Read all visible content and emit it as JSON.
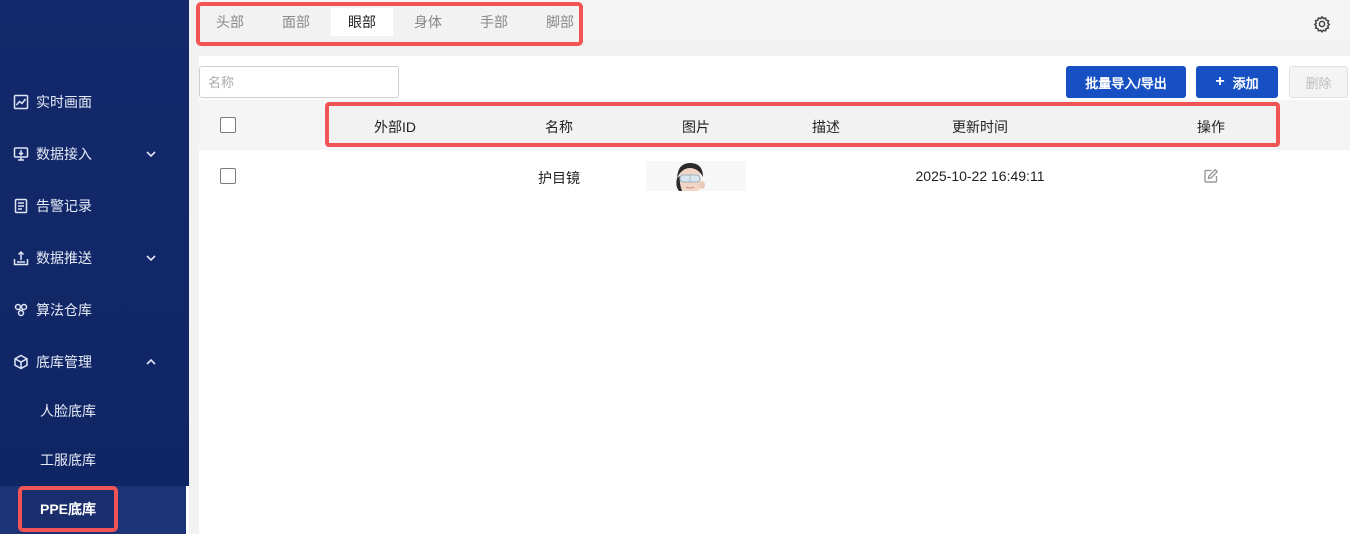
{
  "sidebar": {
    "items": [
      {
        "label": "实时画面",
        "icon": "chart-line-icon"
      },
      {
        "label": "数据接入",
        "icon": "monitor-download-icon",
        "expand": "chevron-down-icon"
      },
      {
        "label": "告警记录",
        "icon": "document-icon"
      },
      {
        "label": "数据推送",
        "icon": "upload-tray-icon",
        "expand": "chevron-down-icon"
      },
      {
        "label": "算法仓库",
        "icon": "algorithm-icon"
      },
      {
        "label": "底库管理",
        "icon": "cube-icon",
        "expand": "chevron-up-icon"
      }
    ],
    "sub_items": [
      {
        "label": "人脸底库"
      },
      {
        "label": "工服底库"
      },
      {
        "label": "PPE底库"
      }
    ]
  },
  "tabs": [
    "头部",
    "面部",
    "眼部",
    "身体",
    "手部",
    "脚部"
  ],
  "active_tab": "眼部",
  "toolbar": {
    "search_placeholder": "名称",
    "import_export_label": "批量导入/导出",
    "add_label": "添加",
    "delete_label": "删除"
  },
  "table": {
    "columns": [
      "外部ID",
      "名称",
      "图片",
      "描述",
      "更新时间",
      "操作"
    ],
    "rows": [
      {
        "external_id": "",
        "name": "护目镜",
        "image": "goggles-person-thumbnail",
        "description": "",
        "updated_at": "2025-10-22 16:49:11",
        "action_icon": "edit-icon"
      }
    ]
  },
  "colors": {
    "sidebar_bg": "#13296b",
    "primary": "#1650c2",
    "highlight": "#f05454"
  }
}
